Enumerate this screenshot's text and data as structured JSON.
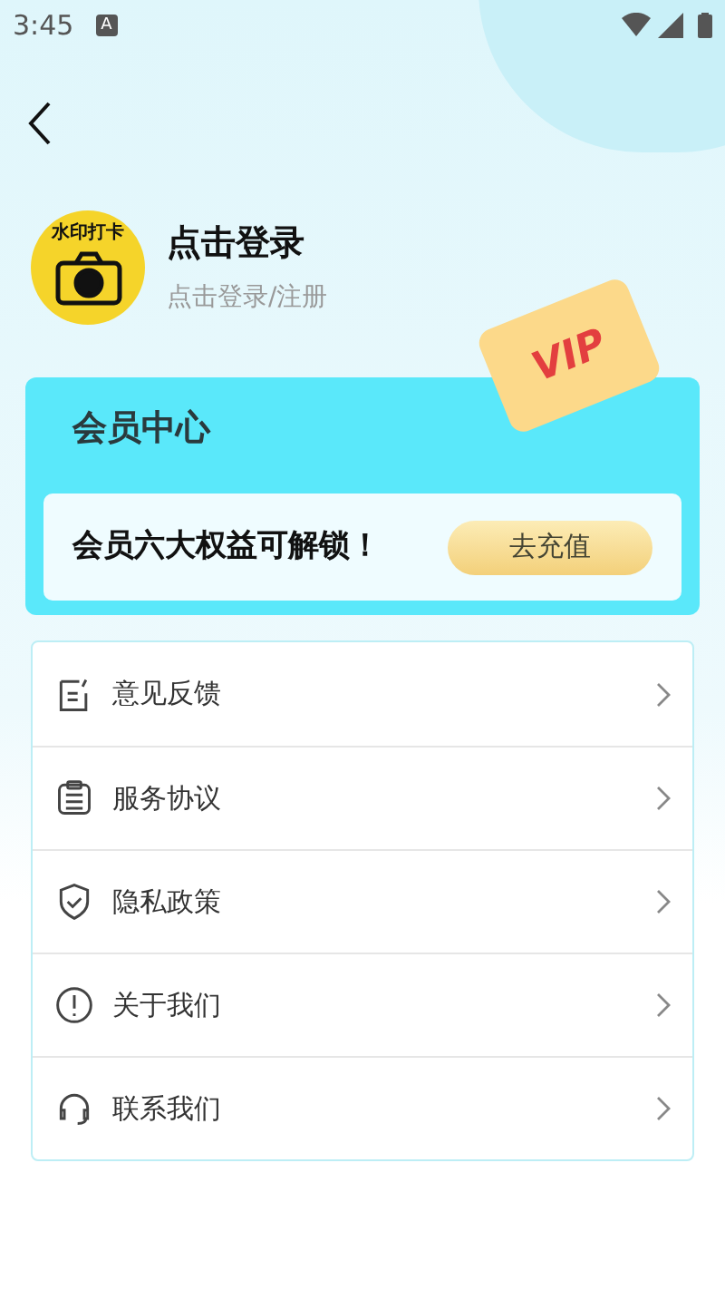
{
  "status_bar": {
    "time": "3:45",
    "notification": "A"
  },
  "profile": {
    "logo_text": "水印打卡",
    "name": "点击登录",
    "subtitle": "点击登录/注册"
  },
  "vip_card": {
    "title": "会员中心",
    "badge": "VIP",
    "message": "会员六大权益可解锁！",
    "button": "去充值"
  },
  "menu": [
    {
      "kind": "feedback",
      "label": "意见反馈"
    },
    {
      "kind": "agreement",
      "label": "服务协议"
    },
    {
      "kind": "privacy",
      "label": "隐私政策"
    },
    {
      "kind": "about",
      "label": "关于我们"
    },
    {
      "kind": "contact",
      "label": "联系我们"
    }
  ]
}
